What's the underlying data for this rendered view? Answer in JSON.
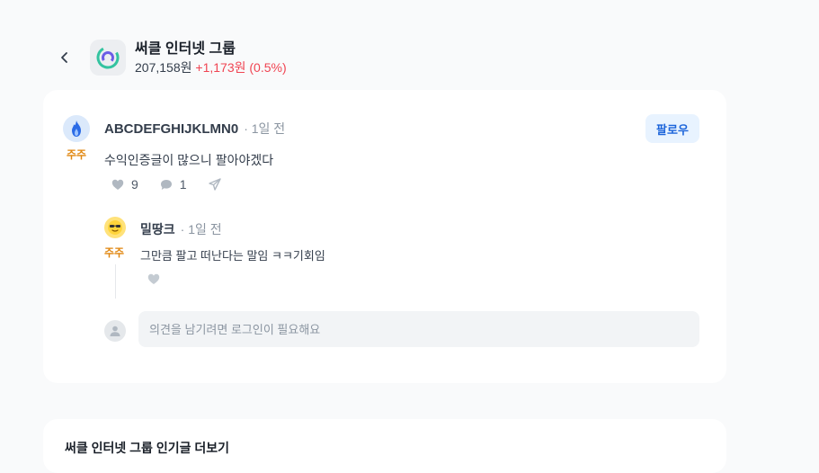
{
  "header": {
    "stock_name": "써클 인터넷 그룹",
    "price": "207,158원",
    "change": "+1,173원 (0.5%)",
    "logo_icon": "circle-logo-icon"
  },
  "post": {
    "author": "ABCDEFGHIJKLMN0",
    "time": "· 1일 전",
    "badge": "주주",
    "follow_label": "팔로우",
    "content": "수익인증글이 많으니 팔아야겠다",
    "like_count": "9",
    "comment_count": "1"
  },
  "reply": {
    "author": "밀땅크",
    "time": "· 1일 전",
    "badge": "주주",
    "content": "그만큼 팔고 떠난다는 말임 ㅋㅋ기회임"
  },
  "comment_input": {
    "placeholder": "의견을 남기려면 로그인이 필요해요"
  },
  "more_section": {
    "title": "써클 인터넷 그룹 인기글 더보기"
  },
  "colors": {
    "accent_blue": "#1b64da",
    "follow_bg": "#e8f3ff",
    "price_up": "#f04452",
    "badge_gold": "#e0860e"
  }
}
